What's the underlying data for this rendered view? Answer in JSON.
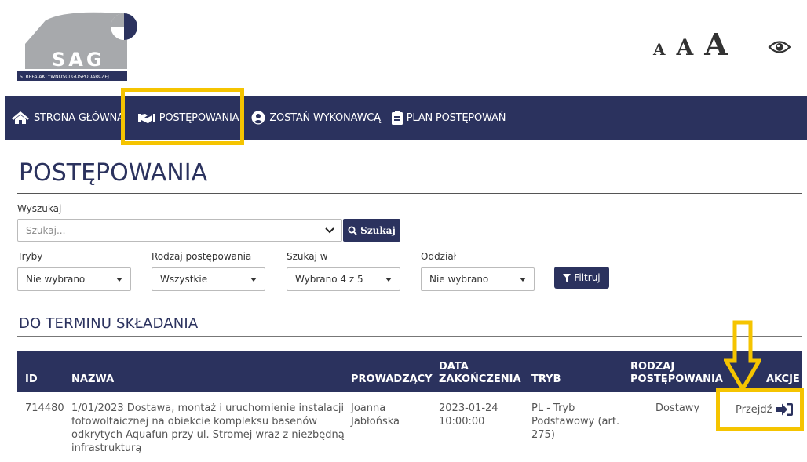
{
  "logo": {
    "text": "SAG",
    "subtitle": "STREFA AKTYWNOŚCI GOSPODARCZEJ"
  },
  "accessibility": {
    "font_small": "A",
    "font_medium": "A",
    "font_large": "A",
    "contrast_icon": "eye-icon"
  },
  "nav": {
    "items": [
      {
        "label": "STRONA GŁÓWNA",
        "icon": "home-icon"
      },
      {
        "label": "POSTĘPOWANIA",
        "icon": "handshake-icon"
      },
      {
        "label": "ZOSTAŃ WYKONAWCĄ",
        "icon": "user-circle-icon"
      },
      {
        "label": "PLAN POSTĘPOWAŃ",
        "icon": "clipboard-icon"
      }
    ]
  },
  "page": {
    "title": "POSTĘPOWANIA"
  },
  "search": {
    "label": "Wyszukaj",
    "placeholder": "Szukaj...",
    "button_label": "Szukaj"
  },
  "filters": {
    "tryby": {
      "label": "Tryby",
      "value": "Nie wybrano"
    },
    "rodzaj": {
      "label": "Rodzaj postępowania",
      "value": "Wszystkie"
    },
    "szukaj_w": {
      "label": "Szukaj w",
      "value": "Wybrano 4 z 5"
    },
    "oddzial": {
      "label": "Oddział",
      "value": "Nie wybrano"
    },
    "filter_button": "Filtruj"
  },
  "section": {
    "title": "DO TERMINU SKŁADANIA"
  },
  "table": {
    "headers": {
      "id": "ID",
      "nazwa": "NAZWA",
      "prowadzacy": "PROWADZĄCY",
      "data_line1": "DATA",
      "data_line2": "ZAKOŃCZENIA",
      "tryb": "TRYB",
      "rodzaj_line1": "RODZAJ",
      "rodzaj_line2": "POSTĘPOWANIA",
      "akcje": "AKCJE"
    },
    "row": {
      "id": "714480",
      "nazwa_lines": [
        "1/01/2023 Dostawa, montaż i uruchomienie instalacji",
        "fotowoltaicznej na obiekcie kompleksu basenów",
        "odkrytych Aquafun przy ul. Stromej wraz z niezbędną",
        "infrastrukturą"
      ],
      "prowadzacy_lines": [
        "Joanna",
        "Jabłońska"
      ],
      "data_lines": [
        "2023-01-24",
        "10:00:00"
      ],
      "tryb_lines": [
        "PL - Tryb",
        "Podstawowy (art.",
        "275)"
      ],
      "rodzaj": "Dostawy",
      "action_label": "Przejdź",
      "action_icon": "sign-in-arrow-icon"
    }
  },
  "colors": {
    "navy": "#2b325e",
    "highlight": "#f5c400",
    "logo_gray": "#a7a9ac"
  }
}
